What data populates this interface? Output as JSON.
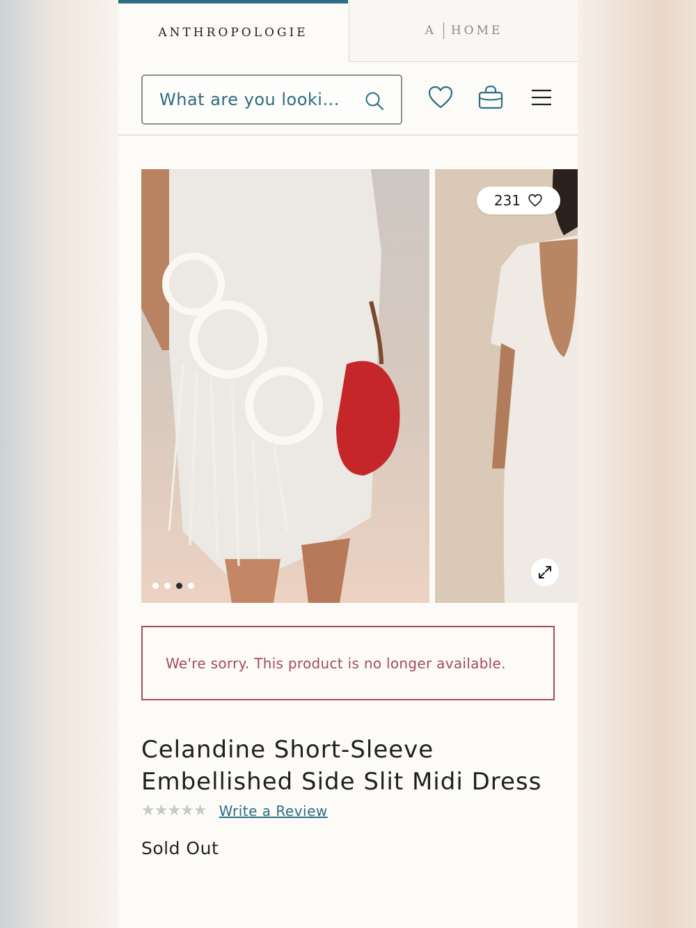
{
  "brand_tabs": {
    "active_label": "ANTHROPOLOGIE",
    "home_mark": "A",
    "home_label": "HOME"
  },
  "header": {
    "search_placeholder": "What are you looki...",
    "icons": [
      "search-icon",
      "heart-icon",
      "bag-icon",
      "menu-icon"
    ],
    "accent_color": "#2b6e85"
  },
  "gallery": {
    "like_count": "231",
    "dots_total": 4,
    "dots_active_index": 2
  },
  "notice": {
    "message": "We're sorry. This product is no longer available.",
    "color": "#a24d57"
  },
  "product": {
    "title_line1": "Celandine Short-Sleeve",
    "title_line2": "Embellished Side Slit Midi Dress",
    "stars": "★★★★★",
    "rating": 0,
    "review_link": "Write a Review",
    "status": "Sold Out"
  }
}
